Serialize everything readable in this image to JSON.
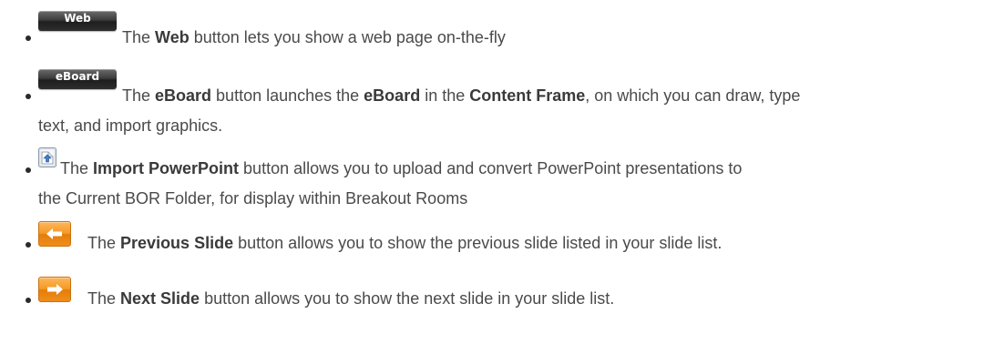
{
  "items": [
    {
      "button_label": "Web",
      "icon": "web-button-icon",
      "prefix": "The ",
      "bold1": "Web",
      "rest1": " button lets you show a web page on-the-fly"
    },
    {
      "button_label": "eBoard",
      "icon": "eboard-button-icon",
      "prefix": "The ",
      "bold1": "eBoard",
      "mid1": " button launches the ",
      "bold2": "eBoard",
      "mid2": " in the ",
      "bold3": "Content Frame",
      "rest1": ", on which you can draw, type",
      "rest2": "text, and import graphics."
    },
    {
      "icon": "import-powerpoint-icon",
      "prefix": "The ",
      "bold1": "Import PowerPoint",
      "rest1": " button allows you to upload and convert PowerPoint presentations to",
      "rest2": "the Current BOR Folder, for display within Breakout Rooms"
    },
    {
      "icon": "previous-slide-arrow-icon",
      "prefix": "The ",
      "bold1": "Previous Slide",
      "rest1": " button allows you to show the previous slide listed in your slide list."
    },
    {
      "icon": "next-slide-arrow-icon",
      "prefix": "The ",
      "bold1": "Next Slide",
      "rest1": " button allows you to show the next slide in your slide list."
    }
  ],
  "colors": {
    "text": "#4a4a4a",
    "orange": "#f39a26",
    "dark_button": "#2e2e2e"
  }
}
